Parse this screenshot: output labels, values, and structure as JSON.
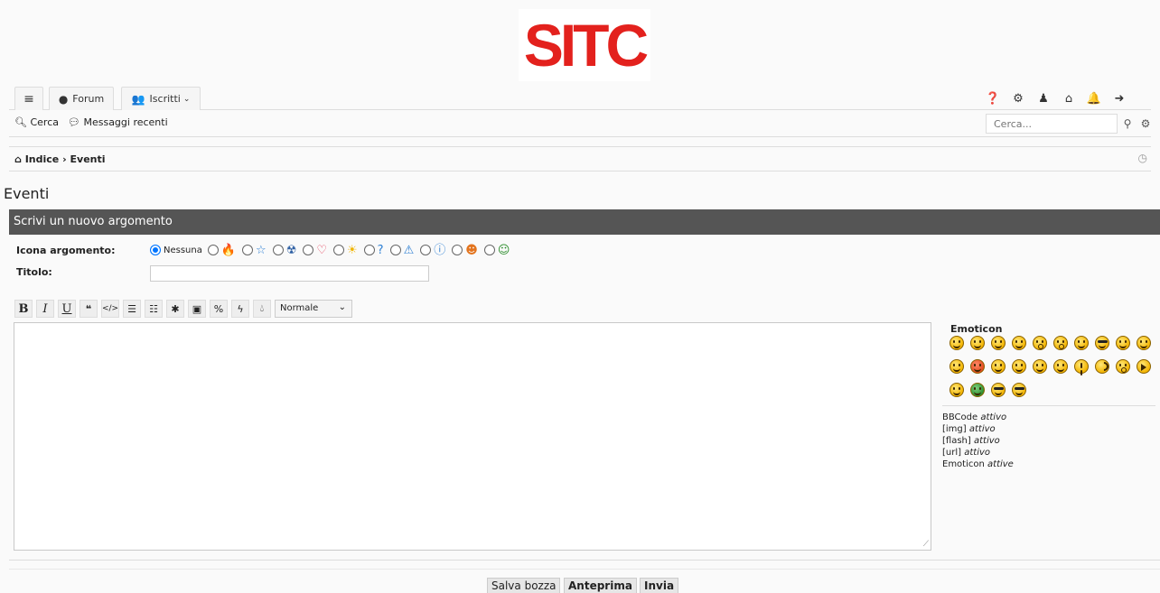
{
  "logo": {
    "text": "SITC",
    "color": "#e3211d"
  },
  "topnav": {
    "menu_icon": "hamburger-icon",
    "forum_label": "Forum",
    "members_label": "Iscritti",
    "right_icons": [
      "help-icon",
      "settings-icon",
      "user-icon",
      "inbox-icon",
      "bell-icon",
      "logout-icon"
    ]
  },
  "subnav": {
    "search_label": "Cerca",
    "recent_label": "Messaggi recenti",
    "search_placeholder": "Cerca..."
  },
  "breadcrumb": {
    "home": "Indice",
    "separator": "›",
    "current": "Eventi"
  },
  "page_title": "Eventi",
  "panel_title": "Scrivi un nuovo argomento",
  "form": {
    "icon_label": "Icona argomento:",
    "no_icon_label": "Nessuna",
    "topic_icons": [
      {
        "name": "fire-icon",
        "glyph": "🔥"
      },
      {
        "name": "star-icon",
        "glyph": "☆"
      },
      {
        "name": "radioactive-icon",
        "glyph": "☢"
      },
      {
        "name": "heart-icon",
        "glyph": "♡"
      },
      {
        "name": "sun-icon",
        "glyph": "☀"
      },
      {
        "name": "question-icon",
        "glyph": "?"
      },
      {
        "name": "warning-icon",
        "glyph": "⚠"
      },
      {
        "name": "info-icon",
        "glyph": "ⓘ"
      },
      {
        "name": "smile-icon",
        "glyph": "☻"
      },
      {
        "name": "grin-icon",
        "glyph": "☺"
      }
    ],
    "title_label": "Titolo:",
    "title_value": ""
  },
  "toolbar": {
    "bold": "B",
    "italic": "I",
    "underline": "U",
    "size_value": "Normale"
  },
  "emoticons": {
    "title": "Emoticon",
    "bb_lines": [
      {
        "label": "BBCode ",
        "state": "attivo"
      },
      {
        "label": "[img] ",
        "state": "attivo"
      },
      {
        "label": "[flash] ",
        "state": "attivo"
      },
      {
        "label": "[url] ",
        "state": "attivo"
      },
      {
        "label": "Emoticon ",
        "state": "attive"
      }
    ]
  },
  "buttons": {
    "draft": "Salva bozza",
    "preview": "Anteprima",
    "submit": "Invia"
  }
}
